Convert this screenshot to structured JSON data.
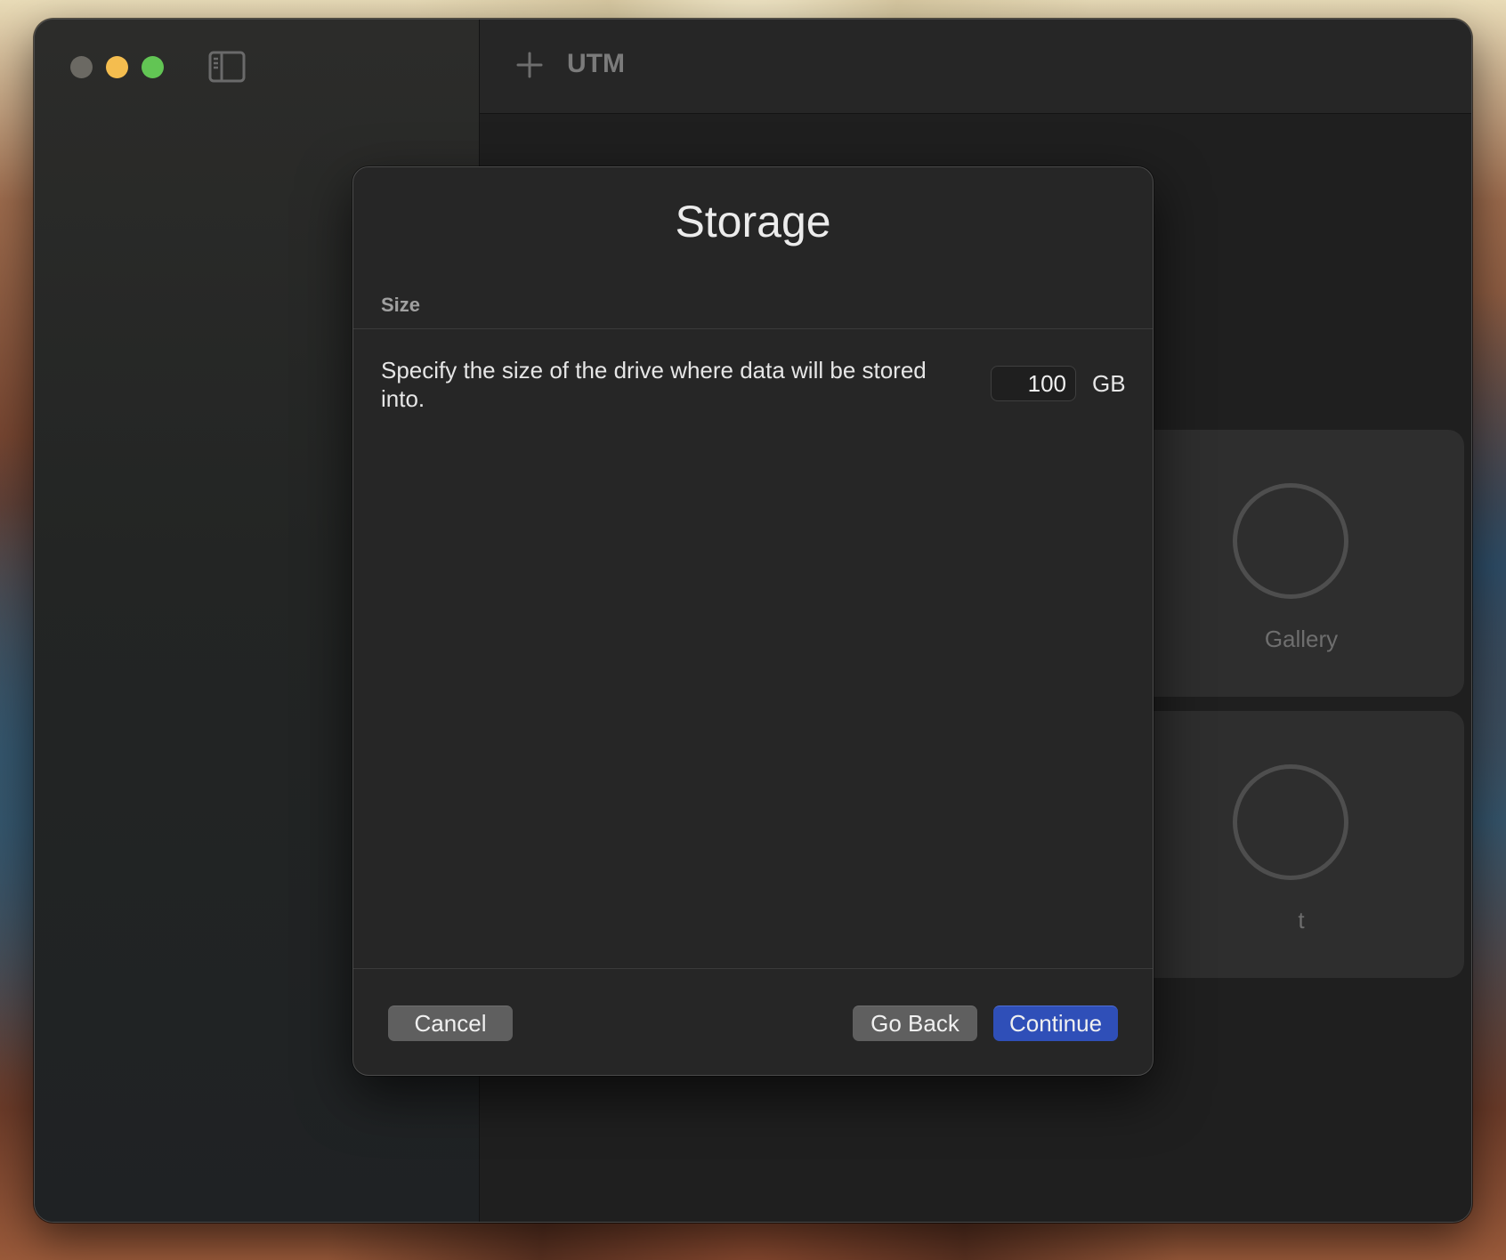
{
  "window": {
    "app_title": "UTM"
  },
  "background_cards": {
    "card1_label": "Gallery",
    "card2_label": "t"
  },
  "dialog": {
    "title": "Storage",
    "section_label": "Size",
    "description": "Specify the size of the drive where data will be stored into.",
    "size_value": "100",
    "size_unit": "GB",
    "cancel_label": "Cancel",
    "go_back_label": "Go Back",
    "continue_label": "Continue"
  },
  "colors": {
    "accent": "#2f4fb8",
    "close_light": "#6b6963",
    "minimize_light": "#f4bd4f",
    "maximize_light": "#62c554"
  },
  "icons": {
    "sidebar_toggle": "sidebar-toggle-icon",
    "add": "plus-icon"
  }
}
